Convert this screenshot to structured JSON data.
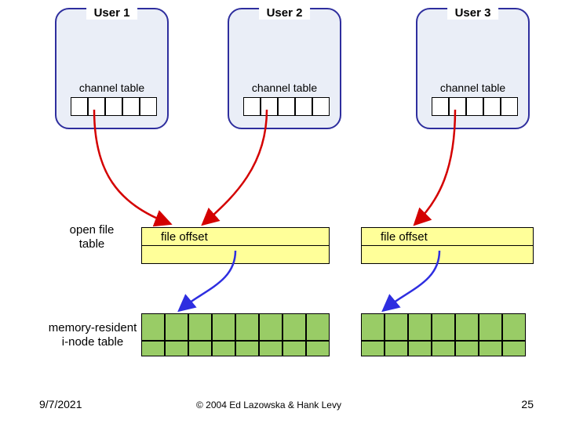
{
  "users": [
    {
      "title": "User 1",
      "channel_label": "channel table"
    },
    {
      "title": "User 2",
      "channel_label": "channel table"
    },
    {
      "title": "User 3",
      "channel_label": "channel table"
    }
  ],
  "open_file_table_label": "open file\ntable",
  "file_offsets": [
    {
      "label": "file offset"
    },
    {
      "label": "file offset"
    }
  ],
  "memory_resident_label": "memory-resident\ni-node table",
  "footer": {
    "date": "9/7/2021",
    "copyright": "© 2004 Ed Lazowska & Hank Levy",
    "page": "25"
  },
  "colors": {
    "user_box_fill": "#eaeef7",
    "user_box_border": "#2e2e9e",
    "offset_fill": "#ffff99",
    "inode_fill": "#99cc66",
    "arrow_red": "#d40000",
    "arrow_blue": "#2e2ee0"
  }
}
